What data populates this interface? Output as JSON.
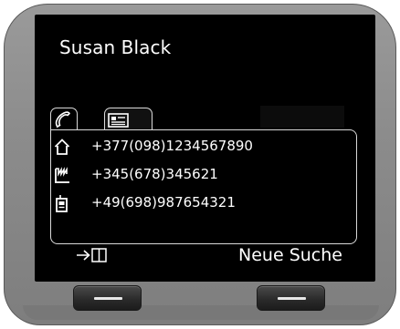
{
  "contact": {
    "name": "Susan Black"
  },
  "tabs": [
    {
      "icon": "phone-handset-icon",
      "active": true
    },
    {
      "icon": "contact-card-icon",
      "active": false
    }
  ],
  "numbers": [
    {
      "type_icon": "home-icon",
      "value": "+377(098)1234567890"
    },
    {
      "type_icon": "office-building-icon",
      "value": "+345(678)345621"
    },
    {
      "type_icon": "mobile-phone-icon",
      "value": "+49(698)987654321"
    }
  ],
  "softkeys": {
    "left_icon": "arrow-to-phonebook-icon",
    "right_label": "Neue Suche"
  },
  "colors": {
    "screen_bg": "#000000",
    "text": "#ffffff",
    "bezel": "#8c8c8c"
  }
}
